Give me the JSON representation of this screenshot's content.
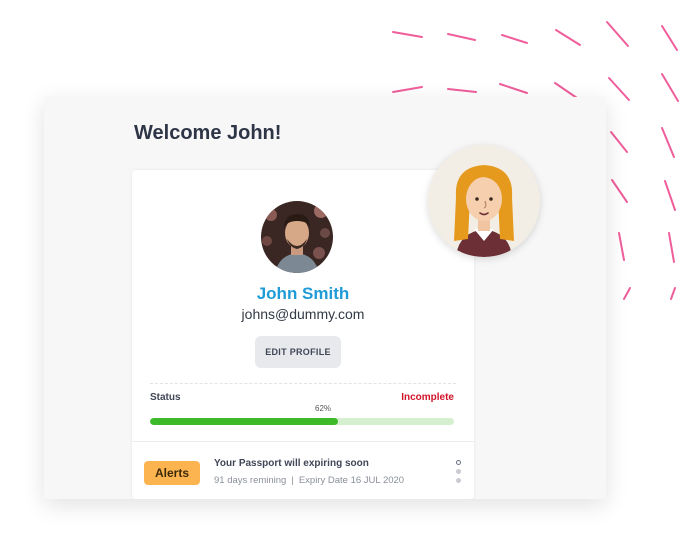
{
  "page": {
    "welcome_text": "Welcome John!"
  },
  "profile": {
    "name": "John Smith",
    "email": "johns@dummy.com",
    "edit_button_label": "EDIT PROFILE"
  },
  "status": {
    "label": "Status",
    "value": "Incomplete",
    "progress_text": "62%",
    "progress": 0.62
  },
  "alerts": {
    "badge_label": "Alerts",
    "title": "Your Passport will expiring soon",
    "remaining": "91 days remining",
    "separator": "|",
    "expiry": "Expiry Date 16 JUL 2020"
  },
  "colors": {
    "accent": "#1f9bd7",
    "status_incomplete": "#d0142a",
    "progress_fill": "#3eb92a",
    "progress_track": "#d5f0cf",
    "alert_badge": "#fbb450",
    "decor_lines": "#ef5e9b"
  },
  "icons": [
    "user-avatar-photo",
    "female-avatar-illustration",
    "scroll-dots-indicator"
  ]
}
